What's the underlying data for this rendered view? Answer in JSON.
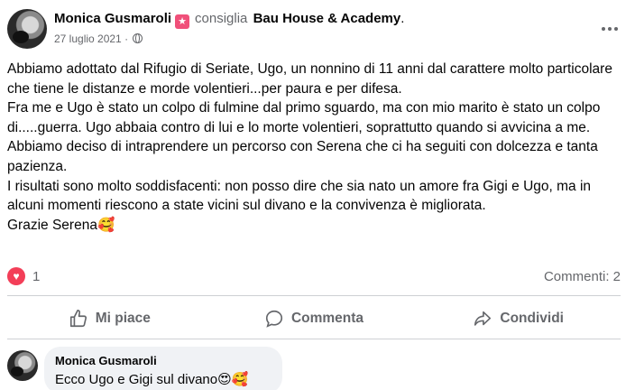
{
  "post": {
    "author": "Monica Gusmaroli",
    "badge_icon": "star-badge-icon",
    "verb": "consiglia",
    "page": "Bau House & Academy",
    "page_suffix": ".",
    "date": "27 luglio 2021",
    "separator": "·",
    "privacy_icon": "globe-icon",
    "paragraphs": [
      "Abbiamo adottato dal Rifugio di Seriate, Ugo, un nonnino di 11 anni dal carattere molto particolare che tiene le distanze e morde volentieri...per paura e per difesa.",
      "Fra me e Ugo è stato un colpo di fulmine dal primo sguardo, ma con mio marito è stato un colpo di.....guerra. Ugo abbaia contro di lui e lo morte volentieri, soprattutto quando si avvicina a me.",
      "Abbiamo deciso di intraprendere un percorso con Serena che ci ha seguiti con dolcezza e tanta pazienza.",
      "I risultati sono molto soddisfacenti: non posso dire che sia nato un amore fra Gigi e Ugo, ma in alcuni momenti riescono a state vicini sul divano e la convivenza è migliorata.",
      "Grazie Serena🥰"
    ]
  },
  "stats": {
    "reaction_icon": "heart-icon",
    "reaction_count": "1",
    "comments": "Commenti: 2"
  },
  "actions": {
    "like": "Mi piace",
    "comment": "Commenta",
    "share": "Condividi"
  },
  "comment": {
    "author": "Monica Gusmaroli",
    "text": "Ecco Ugo e Gigi sul divano😍🥰"
  },
  "colors": {
    "secondary_text": "#65676b",
    "heart": "#f33e58",
    "bubble": "#f0f2f5"
  }
}
